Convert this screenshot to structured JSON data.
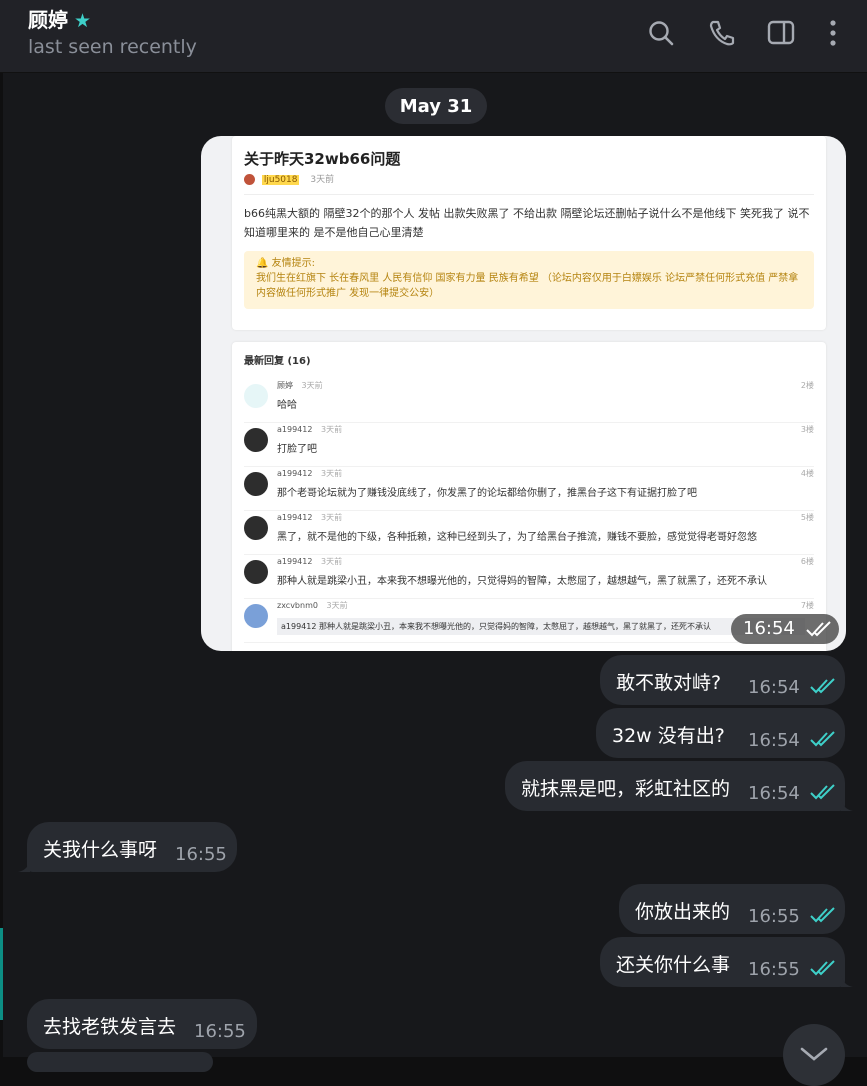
{
  "header": {
    "contact_name": "顾婷",
    "status": "last seen recently",
    "icons": [
      "star-icon",
      "search-icon",
      "phone-icon",
      "sidebar-toggle-icon",
      "more-vert-icon"
    ]
  },
  "date_separator": "May 31",
  "photo": {
    "time": "16:54",
    "post_title": "关于昨天32wb66问题",
    "post_meta": "3天前",
    "post_body": "b66纯黑大额的 隔壁32个的那个人 发帖 出款失败黑了 不给出款 隔壁论坛还删帖子说什么不是他线下 笑死我了 说不知道哪里来的 是不是他自己心里清楚",
    "tip_title": "🔔 友情提示:",
    "tip_body": "我们生在红旗下 长在春风里 人民有信仰 国家有力量 民族有希望 （论坛内容仅用于白嫖娱乐 论坛严禁任何形式充值 严禁拿内容做任何形式推广 发现一律提交公安）",
    "replies_header": "最新回复 (16)",
    "replies": [
      {
        "name": "顾婷",
        "time": "3天前",
        "floor": "2楼",
        "text": "哈哈"
      },
      {
        "name": "a199412",
        "time": "3天前",
        "floor": "3楼",
        "text": "打脸了吧"
      },
      {
        "name": "a199412",
        "time": "3天前",
        "floor": "4楼",
        "text": "那个老哥论坛就为了赚钱没底线了，你发黑了的论坛都给你删了，推黑台子这下有证据打脸了吧"
      },
      {
        "name": "a199412",
        "time": "3天前",
        "floor": "5楼",
        "text": "黑了，就不是他的下级，各种抵赖，这种已经到头了，为了给黑台子推流，赚钱不要脸，感觉觉得老哥好忽悠"
      },
      {
        "name": "a199412",
        "time": "3天前",
        "floor": "6楼",
        "text": "那种人就是跳梁小丑，本来我不想曝光他的，只觉得妈的智障，太憋屈了，越想越气，黑了就黑了，还死不承认"
      },
      {
        "name": "zxcvbnm0",
        "time": "3天前",
        "floor": "7楼",
        "text": "a199412  那种人就是跳梁小丑，本来我不想曝光他的，只觉得妈的智障，太憋屈了，越想越气，黑了就黑了，还死不承认"
      }
    ]
  },
  "messages": [
    {
      "side": "out",
      "text": "敢不敢对峙?",
      "time": "16:54"
    },
    {
      "side": "out",
      "text": "32w 没有出?",
      "time": "16:54"
    },
    {
      "side": "out",
      "text": "就抹黑是吧，彩虹社区的",
      "time": "16:54"
    },
    {
      "side": "in",
      "text": "关我什么事呀",
      "time": "16:55"
    },
    {
      "side": "out",
      "text": "你放出来的",
      "time": "16:55"
    },
    {
      "side": "out",
      "text": "还关你什么事",
      "time": "16:55"
    },
    {
      "side": "in",
      "text": "去找老铁发言去",
      "time": "16:55"
    }
  ],
  "colors": {
    "header_bg": "#212227",
    "chat_bg": "#17181b",
    "bubble_bg": "#282b31",
    "read_tick": "#3ed0c9",
    "accent": "#0c8e84"
  }
}
